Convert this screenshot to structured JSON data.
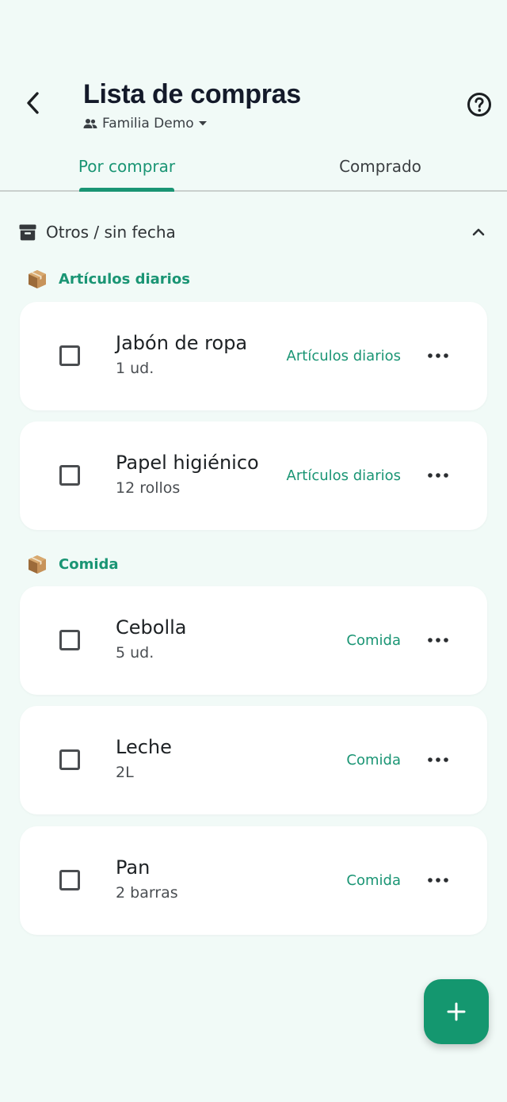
{
  "header": {
    "title": "Lista de compras",
    "family": "Familia Demo"
  },
  "tabs": [
    {
      "label": "Por comprar",
      "active": true
    },
    {
      "label": "Comprado",
      "active": false
    }
  ],
  "section": {
    "title": "Otros / sin fecha",
    "expanded": true
  },
  "groups": [
    {
      "title": "Artículos diarios",
      "items": [
        {
          "name": "Jabón de ropa",
          "qty": "1 ud.",
          "category": "Artículos diarios",
          "checked": false
        },
        {
          "name": "Papel higiénico",
          "qty": "12 rollos",
          "category": "Artículos diarios",
          "checked": false
        }
      ]
    },
    {
      "title": "Comida",
      "items": [
        {
          "name": "Cebolla",
          "qty": "5 ud.",
          "category": "Comida",
          "checked": false
        },
        {
          "name": "Leche",
          "qty": "2L",
          "category": "Comida",
          "checked": false
        },
        {
          "name": "Pan",
          "qty": "2 barras",
          "category": "Comida",
          "checked": false
        }
      ]
    }
  ],
  "colors": {
    "accent": "#1a9574",
    "background": "#f1faf7",
    "fab": "#14976f"
  }
}
